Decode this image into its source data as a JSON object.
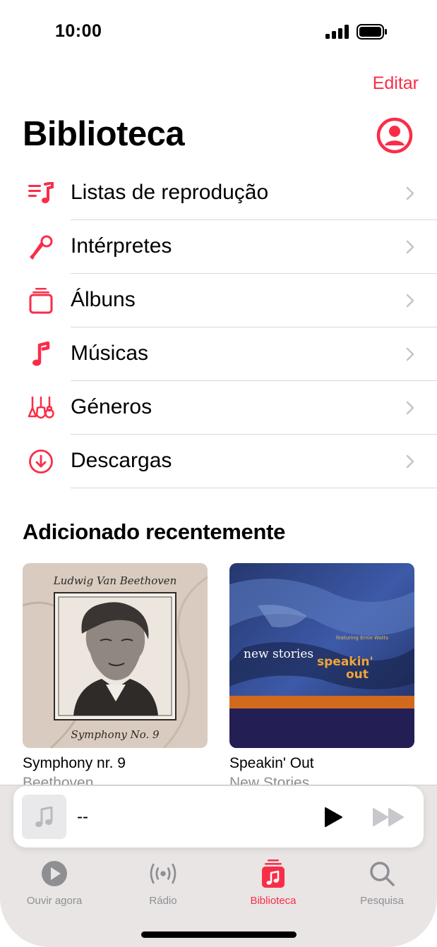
{
  "status_bar": {
    "time": "10:00"
  },
  "header": {
    "edit_label": "Editar",
    "title": "Biblioteca"
  },
  "library_items": [
    {
      "label": "Listas de reprodução",
      "icon": "playlist-icon"
    },
    {
      "label": "Intérpretes",
      "icon": "microphone-icon"
    },
    {
      "label": "Álbuns",
      "icon": "album-stack-icon"
    },
    {
      "label": "Músicas",
      "icon": "music-note-icon"
    },
    {
      "label": "Géneros",
      "icon": "guitars-icon"
    },
    {
      "label": "Descargas",
      "icon": "download-circle-icon"
    }
  ],
  "recently_added": {
    "title": "Adicionado recentemente",
    "albums": [
      {
        "title": "Symphony nr. 9",
        "artist": "Beethoven",
        "cover_header": "Ludwig Van Beethoven",
        "cover_footer": "Symphony No. 9"
      },
      {
        "title": "Speakin' Out",
        "artist": "New Stories",
        "cover_text_1": "new stories",
        "cover_text_2": "speakin'",
        "cover_text_3": "out",
        "cover_small": "featuring Ernie Watts"
      }
    ]
  },
  "mini_player": {
    "title": "--"
  },
  "tabs": [
    {
      "label": "Ouvir agora",
      "icon": "play-circle-icon"
    },
    {
      "label": "Rádio",
      "icon": "radio-waves-icon"
    },
    {
      "label": "Biblioteca",
      "icon": "library-icon",
      "active": true
    },
    {
      "label": "Pesquisa",
      "icon": "search-icon"
    }
  ],
  "colors": {
    "accent": "#fa2d48",
    "secondary_text": "#8e8e93",
    "separator": "#d8d8dc",
    "dock": "#e8e5e4"
  }
}
